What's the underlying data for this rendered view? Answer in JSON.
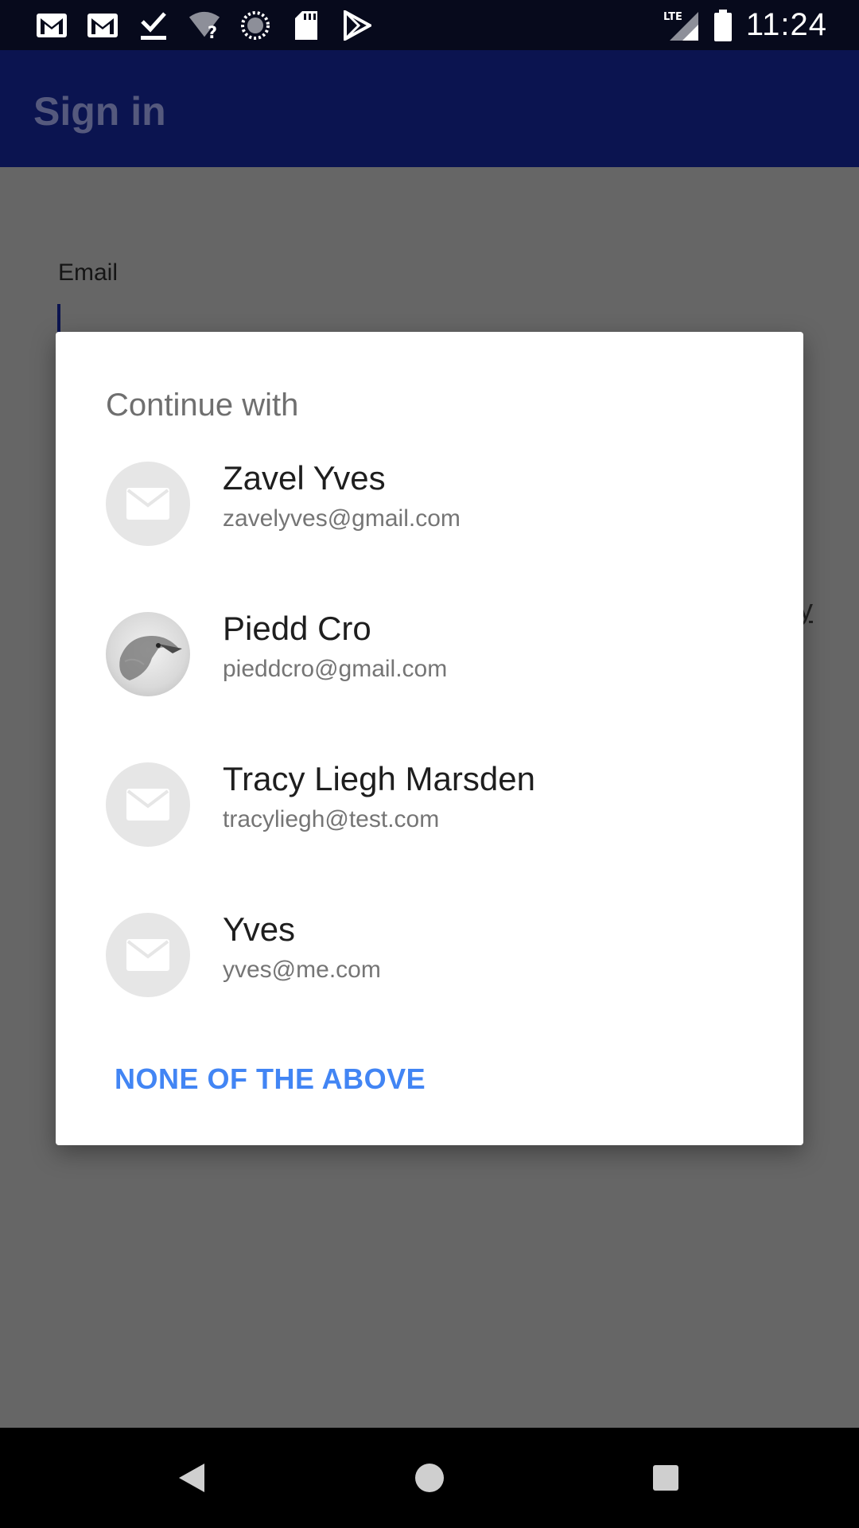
{
  "status_bar": {
    "time": "11:24",
    "network": "LTE",
    "icons": [
      "gmail-icon",
      "gmail-icon",
      "download-done-icon",
      "wifi-unknown-icon",
      "sync-icon",
      "sd-card-icon",
      "play-store-icon"
    ]
  },
  "app_bar": {
    "title": "Sign in",
    "color": "#0b1450"
  },
  "form": {
    "email_label": "Email"
  },
  "dialog": {
    "title": "Continue with",
    "accounts": [
      {
        "name": "Zavel Yves",
        "email": "zavelyves@gmail.com",
        "avatar": "mail-icon"
      },
      {
        "name": "Piedd Cro",
        "email": "pieddcro@gmail.com",
        "avatar": "photo"
      },
      {
        "name": "Tracy Liegh Marsden",
        "email": "tracyliegh@test.com",
        "avatar": "mail-icon"
      },
      {
        "name": "Yves",
        "email": "yves@me.com",
        "avatar": "mail-icon"
      }
    ],
    "none_label": "NONE OF THE ABOVE",
    "accent_color": "#4285f4"
  },
  "nav_bar": {
    "buttons": [
      "back-icon",
      "home-icon",
      "recents-icon"
    ]
  }
}
